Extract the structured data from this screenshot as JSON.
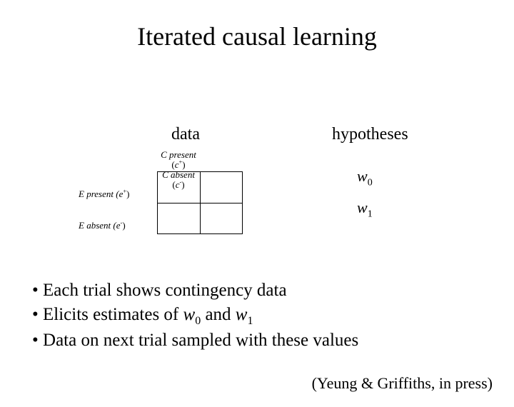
{
  "title": "Iterated causal learning",
  "mid": {
    "data_label": "data",
    "hypotheses_label": "hypotheses",
    "col1_line1": "C present",
    "col1_line2_open": "(",
    "col1_var": "c",
    "col1_sup": "+",
    "col1_line2_close": ")",
    "col2_line1": "C absent",
    "col2_line2_open": "(",
    "col2_var": "c",
    "col2_sup": "-",
    "col2_line2_close": ")",
    "row1": "E present (",
    "row1_var": "e",
    "row1_sup": "+",
    "row1_close": ")",
    "row2": "E absent (",
    "row2_var": "e",
    "row2_sup": "-",
    "row2_close": ")",
    "w0_var": "w",
    "w0_sub": "0",
    "w1_var": "w",
    "w1_sub": "1"
  },
  "bullets": {
    "b1": "Each trial shows contingency data",
    "b2_pre": "Elicits estimates of ",
    "b2_w0_v": "w",
    "b2_w0_s": "0",
    "b2_and": " and ",
    "b2_w1_v": "w",
    "b2_w1_s": "1",
    "b3": "Data on next trial sampled with these values"
  },
  "cite": "(Yeung & Griffiths, in press)",
  "dot": "•"
}
